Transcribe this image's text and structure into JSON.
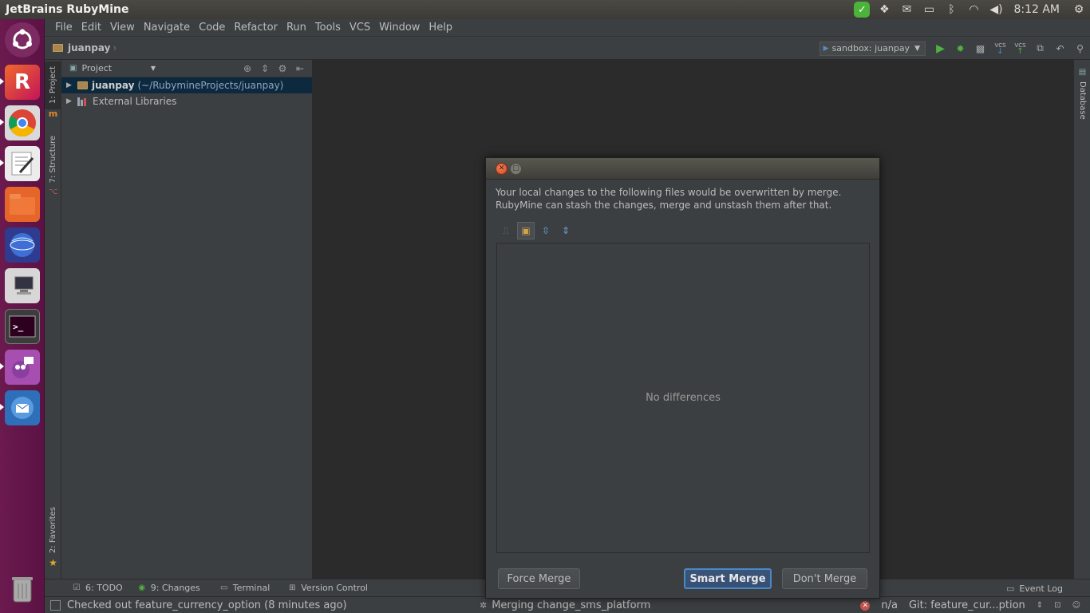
{
  "os_panel": {
    "window_title": "JetBrains RubyMine",
    "clock": "8:12 AM"
  },
  "menu": [
    "File",
    "Edit",
    "View",
    "Navigate",
    "Code",
    "Refactor",
    "Run",
    "Tools",
    "VCS",
    "Window",
    "Help"
  ],
  "navbar": {
    "breadcrumb": "juanpay",
    "run_config": "sandbox: juanpay",
    "vcs_label_1": "VCS",
    "vcs_label_2": "VCS"
  },
  "left_strip": {
    "project_tab": "1: Project",
    "structure_tab": "7: Structure",
    "favorites_tab": "2: Favorites"
  },
  "right_strip": {
    "database_tab": "Database"
  },
  "project_panel": {
    "view_selector": "Project",
    "tree": [
      {
        "label": "juanpay",
        "path": "(~/RubymineProjects/juanpay)"
      },
      {
        "label": "External Libraries"
      }
    ]
  },
  "dialog": {
    "message_line1": "Your local changes to the following files would be overwritten by merge.",
    "message_line2": "RubyMine can stash the changes, merge and unstash them after that.",
    "empty_text": "No differences",
    "force_merge": "Force Merge",
    "smart_merge": "Smart Merge",
    "dont_merge": "Don't Merge"
  },
  "bottom_tabs": {
    "todo": "6: TODO",
    "changes": "9: Changes",
    "terminal": "Terminal",
    "version_control": "Version Control",
    "event_log": "Event Log"
  },
  "status_bar": {
    "message": "Checked out feature_currency_option (8 minutes ago)",
    "progress": "Merging change_sms_platform",
    "position": "n/a",
    "git_branch": "Git: feature_cur...ption"
  },
  "colors": {
    "launcher": "#5c1244",
    "ide_background": "#2b2b2b",
    "panel": "#3c3f41",
    "selection": "#0d293e",
    "primary_button_border": "#4a88c7",
    "run_green": "#4fb33f"
  }
}
